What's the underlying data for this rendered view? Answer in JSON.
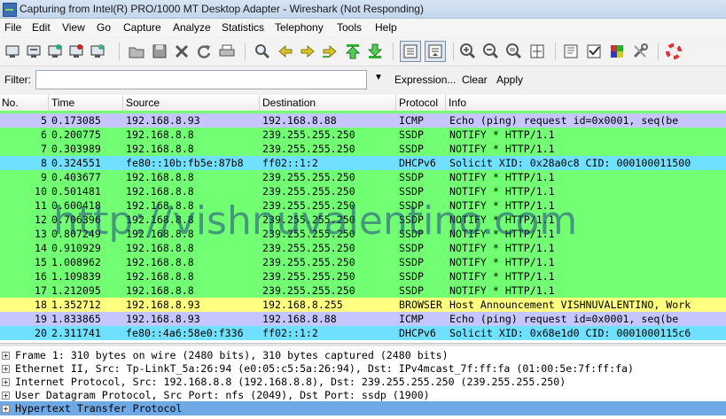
{
  "window": {
    "title": "Capturing from Intel(R) PRO/1000 MT Desktop Adapter - Wireshark (Not Responding)"
  },
  "menu": [
    "File",
    "Edit",
    "View",
    "Go",
    "Capture",
    "Analyze",
    "Statistics",
    "Telephony",
    "Tools",
    "Help"
  ],
  "toolbar_icons": [
    "interface-list-icon",
    "capture-options-icon",
    "capture-start-icon",
    "capture-stop-icon",
    "capture-restart-icon",
    "open-file-icon",
    "save-file-icon",
    "close-file-icon",
    "reload-icon",
    "print-icon",
    "find-packet-icon",
    "go-back-icon",
    "go-forward-icon",
    "go-to-packet-icon",
    "go-first-icon",
    "go-last-icon",
    "colorize-icon",
    "auto-scroll-icon",
    "zoom-in-icon",
    "zoom-out-icon",
    "zoom-normal-icon",
    "resize-columns-icon",
    "capture-filters-icon",
    "display-filters-icon",
    "coloring-rules-icon",
    "preferences-icon",
    "help-icon"
  ],
  "filter": {
    "label": "Filter:",
    "value": "",
    "expression": "Expression...",
    "clear": "Clear",
    "apply": "Apply"
  },
  "columns": {
    "no": "No.",
    "time": "Time",
    "source": "Source",
    "destination": "Destination",
    "protocol": "Protocol",
    "info": "Info"
  },
  "colors": {
    "icmp": "#c6c6ff",
    "ssdp": "#73ff73",
    "dhcpv6": "#70e0ff",
    "browser": "#ffff80",
    "selected": "#6fa9e5"
  },
  "packets": [
    {
      "no": "5",
      "time": "0.173085",
      "src": "192.168.8.93",
      "dst": "192.168.8.88",
      "proto": "ICMP",
      "info": "Echo (ping) request  id=0x0001, seq(be",
      "color": "icmp"
    },
    {
      "no": "6",
      "time": "0.200775",
      "src": "192.168.8.8",
      "dst": "239.255.255.250",
      "proto": "SSDP",
      "info": "NOTIFY * HTTP/1.1",
      "color": "ssdp"
    },
    {
      "no": "7",
      "time": "0.303989",
      "src": "192.168.8.8",
      "dst": "239.255.255.250",
      "proto": "SSDP",
      "info": "NOTIFY * HTTP/1.1",
      "color": "ssdp"
    },
    {
      "no": "8",
      "time": "0.324551",
      "src": "fe80::10b:fb5e:87b8",
      "dst": "ff02::1:2",
      "proto": "DHCPv6",
      "info": "Solicit XID: 0x28a0c8 CID: 000100011500",
      "color": "dhcpv6"
    },
    {
      "no": "9",
      "time": "0.403677",
      "src": "192.168.8.8",
      "dst": "239.255.255.250",
      "proto": "SSDP",
      "info": "NOTIFY * HTTP/1.1",
      "color": "ssdp"
    },
    {
      "no": "10",
      "time": "0.501481",
      "src": "192.168.8.8",
      "dst": "239.255.255.250",
      "proto": "SSDP",
      "info": "NOTIFY * HTTP/1.1",
      "color": "ssdp"
    },
    {
      "no": "11",
      "time": "0.600418",
      "src": "192.168.8.8",
      "dst": "239.255.255.250",
      "proto": "SSDP",
      "info": "NOTIFY * HTTP/1.1",
      "color": "ssdp"
    },
    {
      "no": "12",
      "time": "0.706396",
      "src": "192.168.8.8",
      "dst": "239.255.255.250",
      "proto": "SSDP",
      "info": "NOTIFY * HTTP/1.1",
      "color": "ssdp"
    },
    {
      "no": "13",
      "time": "0.807249",
      "src": "192.168.8.8",
      "dst": "239.255.255.250",
      "proto": "SSDP",
      "info": "NOTIFY * HTTP/1.1",
      "color": "ssdp"
    },
    {
      "no": "14",
      "time": "0.910929",
      "src": "192.168.8.8",
      "dst": "239.255.255.250",
      "proto": "SSDP",
      "info": "NOTIFY * HTTP/1.1",
      "color": "ssdp"
    },
    {
      "no": "15",
      "time": "1.008962",
      "src": "192.168.8.8",
      "dst": "239.255.255.250",
      "proto": "SSDP",
      "info": "NOTIFY * HTTP/1.1",
      "color": "ssdp"
    },
    {
      "no": "16",
      "time": "1.109839",
      "src": "192.168.8.8",
      "dst": "239.255.255.250",
      "proto": "SSDP",
      "info": "NOTIFY * HTTP/1.1",
      "color": "ssdp"
    },
    {
      "no": "17",
      "time": "1.212095",
      "src": "192.168.8.8",
      "dst": "239.255.255.250",
      "proto": "SSDP",
      "info": "NOTIFY * HTTP/1.1",
      "color": "ssdp"
    },
    {
      "no": "18",
      "time": "1.352712",
      "src": "192.168.8.93",
      "dst": "192.168.8.255",
      "proto": "BROWSER",
      "info": "Host Announcement VISHNUVALENTINO, Work",
      "color": "browser"
    },
    {
      "no": "19",
      "time": "1.833865",
      "src": "192.168.8.93",
      "dst": "192.168.8.88",
      "proto": "ICMP",
      "info": "Echo (ping) request  id=0x0001, seq(be",
      "color": "icmp"
    },
    {
      "no": "20",
      "time": "2.311741",
      "src": "fe80::4a6:58e0:f336",
      "dst": "ff02::1:2",
      "proto": "DHCPv6",
      "info": "Solicit XID: 0x68e1d0 CID: 0001000115c6",
      "color": "dhcpv6"
    }
  ],
  "watermark": "http://vishnuvalentino.com",
  "details": [
    {
      "text": "Frame 1: 310 bytes on wire (2480 bits), 310 bytes captured (2480 bits)",
      "selected": false
    },
    {
      "text": "Ethernet II, Src: Tp-LinkT_5a:26:94 (e0:05:c5:5a:26:94), Dst: IPv4mcast_7f:ff:fa (01:00:5e:7f:ff:fa)",
      "selected": false
    },
    {
      "text": "Internet Protocol, Src: 192.168.8.8 (192.168.8.8), Dst: 239.255.255.250 (239.255.255.250)",
      "selected": false
    },
    {
      "text": "User Datagram Protocol, Src Port: nfs (2049), Dst Port: ssdp (1900)",
      "selected": false
    },
    {
      "text": "Hypertext Transfer Protocol",
      "selected": true
    }
  ]
}
